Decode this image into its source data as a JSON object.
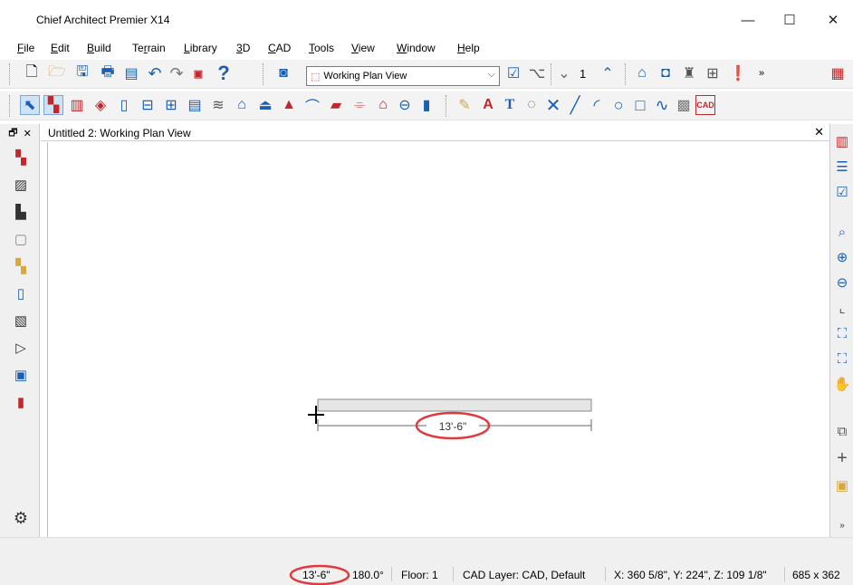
{
  "window": {
    "title": "Chief Architect Premier X14",
    "minimize": "—",
    "maximize": "☐",
    "close": "✕"
  },
  "menu": {
    "items": [
      {
        "pre": "",
        "ul": "F",
        "post": "ile"
      },
      {
        "pre": "",
        "ul": "E",
        "post": "dit"
      },
      {
        "pre": "",
        "ul": "B",
        "post": "uild"
      },
      {
        "pre": "Te",
        "ul": "r",
        "post": "rain"
      },
      {
        "pre": "",
        "ul": "L",
        "post": "ibrary"
      },
      {
        "pre": "",
        "ul": "3",
        "post": "D"
      },
      {
        "pre": "",
        "ul": "C",
        "post": "AD"
      },
      {
        "pre": "",
        "ul": "T",
        "post": "ools"
      },
      {
        "pre": "",
        "ul": "V",
        "post": "iew"
      },
      {
        "pre": "",
        "ul": "W",
        "post": "indow"
      },
      {
        "pre": "",
        "ul": "H",
        "post": "elp"
      }
    ]
  },
  "toolbar": {
    "view_select_value": "Working Plan View",
    "floor_number": "1"
  },
  "left_panel": {
    "header_pin": "🗗",
    "header_close": "✕"
  },
  "document": {
    "tab_label": "Untitled 2: Working Plan View",
    "close": "✕"
  },
  "canvas": {
    "dimension_label": "13'-6\""
  },
  "status": {
    "length": "13'-6\"",
    "angle": "180.0°",
    "floor": "Floor: 1",
    "cad_layer": "CAD Layer: CAD,  Default",
    "coordinates": "X: 360 5/8\", Y: 224\", Z: 109 1/8\"",
    "view_size": "685 x 362"
  },
  "colors": {
    "highlight_ellipse": "#e0393e",
    "accent_blue": "#1a5fb4",
    "accent_red": "#c0282d"
  }
}
